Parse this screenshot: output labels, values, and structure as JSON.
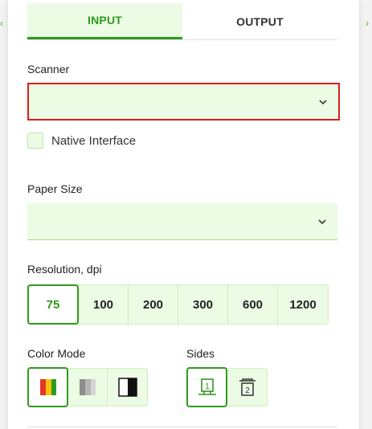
{
  "tabs": [
    {
      "label": "INPUT",
      "active": true
    },
    {
      "label": "OUTPUT",
      "active": false
    }
  ],
  "scanner": {
    "label": "Scanner",
    "value": "",
    "state": "error"
  },
  "native_interface": {
    "label": "Native Interface",
    "checked": false
  },
  "paper_size": {
    "label": "Paper Size",
    "value": ""
  },
  "resolution": {
    "label": "Resolution, dpi",
    "options": [
      "75",
      "100",
      "200",
      "300",
      "600",
      "1200"
    ],
    "selected": "75"
  },
  "color_mode": {
    "label": "Color Mode",
    "options": [
      "color-mode-color-icon",
      "color-mode-grayscale-icon",
      "color-mode-bw-icon"
    ],
    "selected": "color-mode-color-icon"
  },
  "sides": {
    "label": "Sides",
    "options": [
      "single-sided-icon",
      "double-sided-icon"
    ],
    "selected": "single-sided-icon",
    "icon_texts": [
      "1",
      "2"
    ]
  },
  "colors": {
    "accent": "#2f9a1e",
    "field_bg": "#ecfbe3",
    "error": "#d71f1f"
  }
}
